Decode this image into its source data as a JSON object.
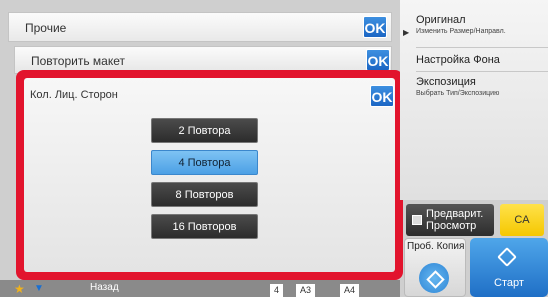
{
  "header": {
    "title": "Прочие",
    "ok_label": "OK"
  },
  "repeat_bar": {
    "title": "Повторить макет",
    "ok_label": "OK"
  },
  "dialog": {
    "title": "Кол. Лиц. Сторон",
    "ok_label": "OK",
    "options": [
      {
        "label": "2 Повтора",
        "selected": false
      },
      {
        "label": "4 Повтора",
        "selected": true
      },
      {
        "label": "8 Повторов",
        "selected": false
      },
      {
        "label": "16 Повторов",
        "selected": false
      }
    ]
  },
  "bottom": {
    "back_label": "Назад",
    "paper_count": "4",
    "paper_size_1": "A3",
    "paper_size_2": "A4"
  },
  "right_panel": {
    "original_title": "Оригинал",
    "original_sub": "Изменить Размер/Направл.",
    "background_title": "Настройка Фона",
    "exposure_title": "Экспозиция",
    "exposure_sub": "Выбрать Тип/Экспозицию",
    "preview_label_1": "Предварит.",
    "preview_label_2": "Просмотр",
    "ca_label": "CA",
    "copy_label": "Проб. Копия",
    "start_label": "Старт"
  },
  "colors": {
    "accent": "#1b66c4",
    "highlight_frame": "#e2142d",
    "selected_option": "#4ca0e5",
    "ca_button": "#f5c700"
  }
}
